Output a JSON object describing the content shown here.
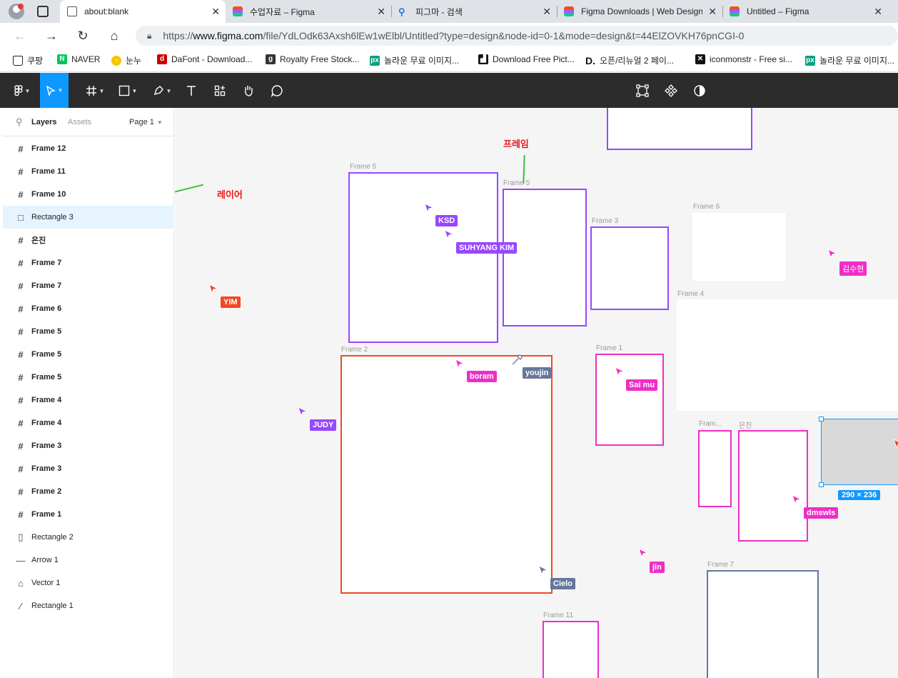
{
  "browser": {
    "tabs": [
      {
        "title": "about:blank"
      },
      {
        "title": "수업자료 – Figma"
      },
      {
        "title": "피그마 - 검색"
      },
      {
        "title": "Figma Downloads | Web Design"
      },
      {
        "title": "Untitled – Figma"
      }
    ],
    "url_prefix": "https://",
    "url_host": "www.figma.com",
    "url_path": "/file/YdLOdk63Axsh6lEw1wElbl/Untitled?type=design&node-id=0-1&mode=design&t=44ElZOVKH76pnCGI-0",
    "bookmarks": [
      {
        "label": "쿠팡"
      },
      {
        "label": "NAVER"
      },
      {
        "label": "눈누"
      },
      {
        "label": "DaFont - Download..."
      },
      {
        "label": "Royalty Free Stock..."
      },
      {
        "label": "놀라운 무료 이미지..."
      },
      {
        "label": "Download Free Pict..."
      },
      {
        "label": "오픈/리뉴얼 2 페이..."
      },
      {
        "label": "iconmonstr - Free si..."
      },
      {
        "label": "놀라운 무료 이미지..."
      }
    ]
  },
  "panel": {
    "tab_layers": "Layers",
    "tab_assets": "Assets",
    "page": "Page 1",
    "layers": [
      {
        "label": "Frame 12",
        "icon": "frame-icon",
        "bold": true
      },
      {
        "label": "Frame 11",
        "icon": "frame-icon",
        "bold": true
      },
      {
        "label": "Frame 10",
        "icon": "frame-icon",
        "bold": true
      },
      {
        "label": "Rectangle 3",
        "icon": "rectangle-icon",
        "bold": false,
        "selected": true
      },
      {
        "label": "은진",
        "icon": "frame-icon",
        "bold": true
      },
      {
        "label": "Frame 7",
        "icon": "frame-icon",
        "bold": true
      },
      {
        "label": "Frame 7",
        "icon": "frame-icon",
        "bold": true
      },
      {
        "label": "Frame 6",
        "icon": "frame-icon",
        "bold": true
      },
      {
        "label": "Frame 5",
        "icon": "frame-icon",
        "bold": true
      },
      {
        "label": "Frame 5",
        "icon": "frame-icon",
        "bold": true
      },
      {
        "label": "Frame 5",
        "icon": "frame-icon",
        "bold": true
      },
      {
        "label": "Frame 4",
        "icon": "frame-icon",
        "bold": true
      },
      {
        "label": "Frame 4",
        "icon": "frame-icon",
        "bold": true
      },
      {
        "label": "Frame 3",
        "icon": "frame-icon",
        "bold": true
      },
      {
        "label": "Frame 3",
        "icon": "frame-icon",
        "bold": true
      },
      {
        "label": "Frame 2",
        "icon": "frame-icon",
        "bold": true
      },
      {
        "label": "Frame 1",
        "icon": "frame-icon",
        "bold": true
      },
      {
        "label": "Rectangle 2",
        "icon": "rectangle-icon",
        "bold": false
      },
      {
        "label": "Arrow 1",
        "icon": "arrow-icon",
        "bold": false
      },
      {
        "label": "Vector 1",
        "icon": "vector-icon",
        "bold": false
      },
      {
        "label": "Rectangle 1",
        "icon": "line-icon",
        "bold": false
      }
    ]
  },
  "canvas": {
    "frame_labels": {
      "frame5a": "Frame 5",
      "frame5b": "Frame 5",
      "frame3": "Frame 3",
      "frame6": "Frame 6",
      "frame4": "Frame 4",
      "frame2": "Frame 2",
      "frame1": "Frame 1",
      "frame_trunc": "Fram...",
      "eunjin": "은진",
      "frame7": "Frame 7",
      "frame11": "Frame 11"
    },
    "selection_size": "290 × 236",
    "annotations": {
      "layer": "레이어",
      "frame": "프레임"
    },
    "cursors": {
      "ksd": "KSD",
      "suhyang": "SUHYANG KIM",
      "yim": "YIM",
      "kimsuhyun": "김수현",
      "boram": "boram",
      "youjin": "youjin",
      "saimu": "Sai mu",
      "judy": "JUDY",
      "dmswls": "dmswls",
      "jin": "jin",
      "cielo": "Cielo"
    },
    "colors": {
      "purple": "#9747ff",
      "pink": "#f02ec6",
      "red": "#f24822",
      "slate": "#667799",
      "blue": "#0d99ff"
    }
  }
}
